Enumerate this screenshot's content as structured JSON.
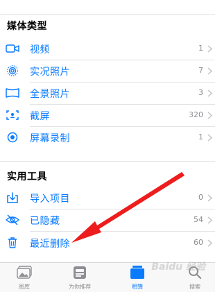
{
  "media_types": {
    "title": "媒体类型",
    "items": [
      {
        "label": "视频",
        "count": "1",
        "icon": "video-camera-icon"
      },
      {
        "label": "实况照片",
        "count": "7",
        "icon": "live-photo-icon"
      },
      {
        "label": "全景照片",
        "count": "3",
        "icon": "panorama-icon"
      },
      {
        "label": "截屏",
        "count": "320",
        "icon": "screenshot-icon"
      },
      {
        "label": "屏幕录制",
        "count": "1",
        "icon": "screen-recording-icon"
      }
    ]
  },
  "utilities": {
    "title": "实用工具",
    "items": [
      {
        "label": "导入项目",
        "count": "0",
        "icon": "import-tray-icon"
      },
      {
        "label": "已隐藏",
        "count": "54",
        "icon": "eye-slash-icon"
      },
      {
        "label": "最近删除",
        "count": "60",
        "icon": "trash-icon"
      }
    ]
  },
  "tabbar": {
    "items": [
      {
        "label": "图库",
        "icon": "photo-library-icon",
        "active": false
      },
      {
        "label": "为你推荐",
        "icon": "for-you-icon",
        "active": false
      },
      {
        "label": "相簿",
        "icon": "albums-icon",
        "active": true
      },
      {
        "label": "搜索",
        "icon": "search-icon",
        "active": false
      }
    ]
  },
  "watermark": "Baidu 经验",
  "colors": {
    "accent": "#0a7aff",
    "annotation_arrow": "#ee1d1d",
    "secondary_text": "#8e8e93"
  }
}
